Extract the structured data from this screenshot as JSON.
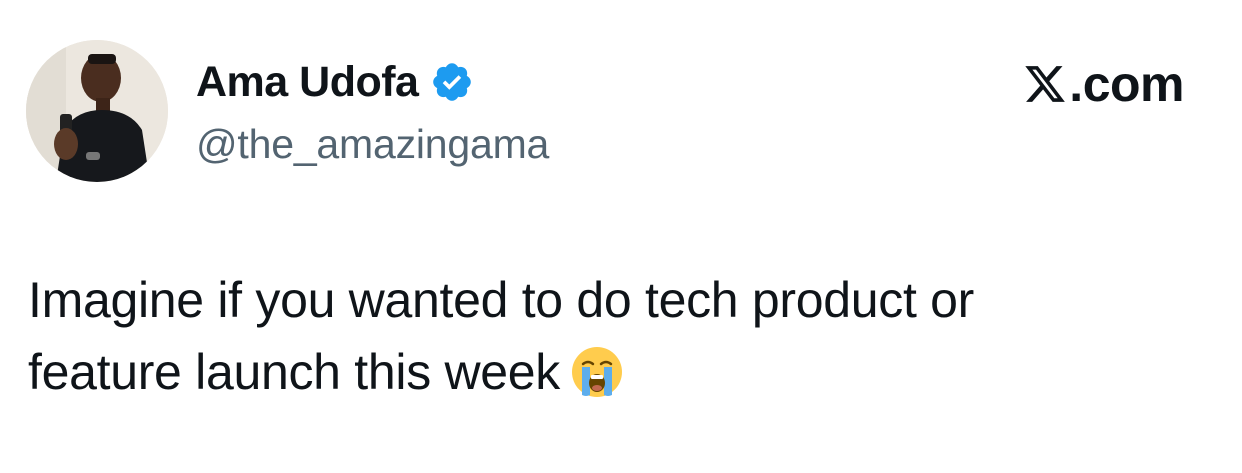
{
  "tweet": {
    "author": {
      "display_name": "Ama Udofa",
      "handle": "@the_amazingama",
      "verified": true,
      "avatar_icon": "avatar-photo"
    },
    "brand": {
      "label": ".com",
      "logo_icon": "x-logo-icon"
    },
    "text_line_1": "Imagine if you wanted to do tech product or",
    "text_line_2": "feature launch this week",
    "emoji": "loudly-crying-face-emoji"
  },
  "colors": {
    "text_primary": "#0f1419",
    "text_secondary": "#536471",
    "verified_blue": "#1d9bf0",
    "background": "#ffffff"
  }
}
